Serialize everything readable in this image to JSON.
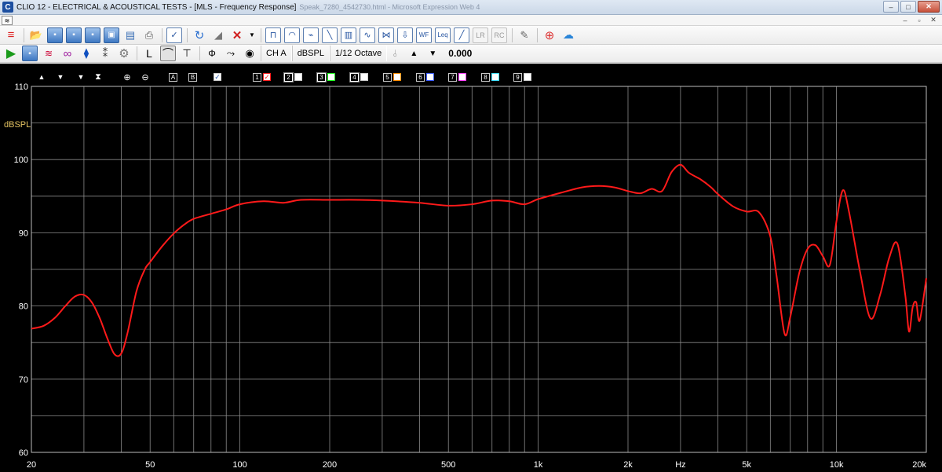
{
  "window": {
    "title": "CLIO 12 - ELECTRICAL & ACOUSTICAL TESTS - [MLS - Frequency Response]",
    "title_faded": "Speak_7280_4542730.html - Microsoft Expression Web 4",
    "minimize": "–",
    "maximize": "□",
    "close": "✕"
  },
  "mdi": {
    "minimize": "–",
    "restore": "▫",
    "close": "✕"
  },
  "toolbar": {
    "channel": "CH A",
    "units": "dBSPL",
    "smoothing": "1/12 Octave",
    "value": "0.000",
    "wf": "WF",
    "leq": "Leq",
    "lr": "LR",
    "rc": "RC"
  },
  "graph_toolbar": {
    "btn_a": "A",
    "btn_b": "B",
    "channels": [
      "1",
      "2",
      "3",
      "4",
      "5",
      "6",
      "7",
      "8",
      "9"
    ],
    "channel_colors": [
      "#ff2020",
      "#ffffff",
      "#20ff20",
      "#ffffff",
      "#ff8c00",
      "#3a5bff",
      "#ff40ff",
      "#40e0ff",
      "#ffffff"
    ]
  },
  "chart_data": {
    "type": "line",
    "xscale": "log",
    "xlim": [
      20,
      20000
    ],
    "ylim": [
      60,
      110
    ],
    "ylabel": "dBSPL",
    "xlabel": "Hz",
    "grid": true,
    "y_ticks": [
      60,
      70,
      80,
      90,
      100,
      110
    ],
    "x_tick_labels": [
      {
        "f": 20,
        "label": "20"
      },
      {
        "f": 50,
        "label": "50"
      },
      {
        "f": 100,
        "label": "100"
      },
      {
        "f": 200,
        "label": "200"
      },
      {
        "f": 500,
        "label": "500"
      },
      {
        "f": 1000,
        "label": "1k"
      },
      {
        "f": 2000,
        "label": "2k"
      },
      {
        "f": 3000,
        "label": "Hz"
      },
      {
        "f": 5000,
        "label": "5k"
      },
      {
        "f": 10000,
        "label": "10k"
      },
      {
        "f": 20000,
        "label": "20k"
      }
    ],
    "series": [
      {
        "color": "#ff1a1a",
        "x": [
          20,
          22,
          24,
          26,
          28,
          30,
          32,
          34,
          36,
          38,
          40,
          42,
          45,
          48,
          50,
          55,
          60,
          65,
          70,
          80,
          90,
          100,
          120,
          140,
          160,
          200,
          250,
          300,
          400,
          500,
          600,
          700,
          800,
          900,
          1000,
          1200,
          1400,
          1600,
          1800,
          2000,
          2200,
          2400,
          2600,
          2800,
          3000,
          3200,
          3500,
          3800,
          4000,
          4500,
          5000,
          5500,
          6000,
          6300,
          6700,
          7000,
          7500,
          8000,
          8500,
          9000,
          9500,
          10000,
          10500,
          11000,
          12000,
          13000,
          14000,
          15000,
          16000,
          17000,
          17500,
          18000,
          18500,
          19000,
          20000
        ],
        "values": [
          76.9,
          77.3,
          78.4,
          80.0,
          81.3,
          81.5,
          80.4,
          78.2,
          75.5,
          73.4,
          73.5,
          76.3,
          82.0,
          85.0,
          86.0,
          88.2,
          89.9,
          91.1,
          91.9,
          92.6,
          93.2,
          93.9,
          94.3,
          94.1,
          94.5,
          94.5,
          94.5,
          94.4,
          94.1,
          93.7,
          93.9,
          94.4,
          94.3,
          93.9,
          94.6,
          95.5,
          96.2,
          96.4,
          96.2,
          95.7,
          95.4,
          96.0,
          95.7,
          98.3,
          99.3,
          98.2,
          97.3,
          96.2,
          95.3,
          93.6,
          92.9,
          92.8,
          89.5,
          84.0,
          76.2,
          78.5,
          84.5,
          87.8,
          88.3,
          86.8,
          85.6,
          91.6,
          95.8,
          93.0,
          84.6,
          78.3,
          81.5,
          86.5,
          88.5,
          81.5,
          76.5,
          79.8,
          80.5,
          78.0,
          83.8
        ]
      }
    ]
  }
}
